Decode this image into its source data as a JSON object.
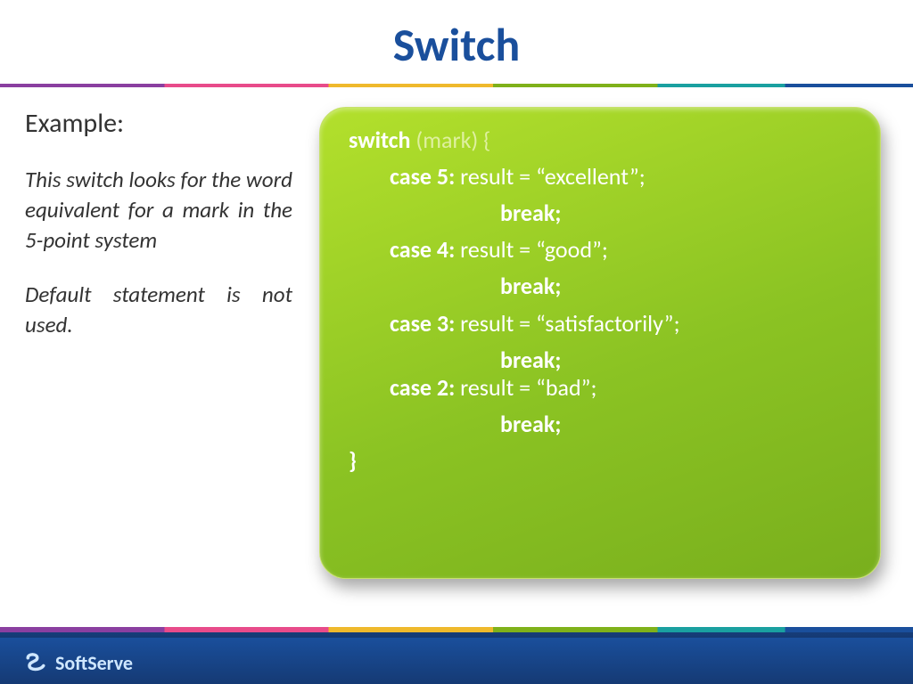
{
  "title": "Switch",
  "left": {
    "example_label": "Example:",
    "paragraph1": "This switch looks for the word equivalent for a mark in the 5-point system",
    "paragraph2": "Default statement is not used."
  },
  "code": {
    "l1_kw": "switch ",
    "l1_open": "(",
    "l1_param": "mark",
    "l1_close": ") {",
    "case5_kw": "case 5:",
    "case5_rest": " result = “excellent”;",
    "break5": "break;",
    "case4_kw": "case 4:",
    "case4_rest": " result = “good”;",
    "break4": "break;",
    "case3_kw": "case 3:",
    "case3_rest": " result = “satisfactorily”;",
    "break3": "break;",
    "case2_kw": "case 2:",
    "case2_rest": " result = “bad”;",
    "break2": "break;",
    "end": "}"
  },
  "footer": {
    "brand": "SoftServe"
  }
}
